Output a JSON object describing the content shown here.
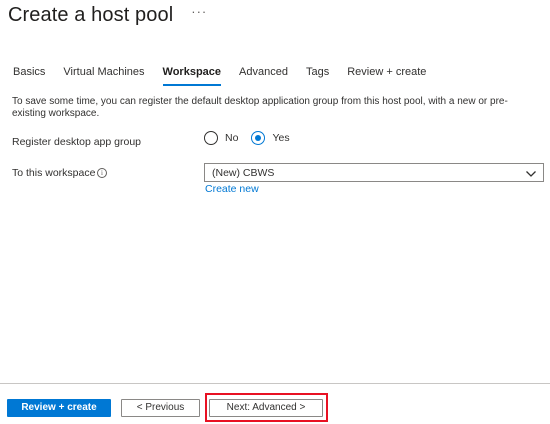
{
  "header": {
    "title": "Create a host pool",
    "more_icon": "more-ellipsis-icon",
    "more_label": "···"
  },
  "tabs": [
    {
      "label": "Basics",
      "active": false
    },
    {
      "label": "Virtual Machines",
      "active": false
    },
    {
      "label": "Workspace",
      "active": true
    },
    {
      "label": "Advanced",
      "active": false
    },
    {
      "label": "Tags",
      "active": false
    },
    {
      "label": "Review + create",
      "active": false
    }
  ],
  "description": "To save some time, you can register the default desktop application group from this host pool, with a new or pre-existing workspace.",
  "register": {
    "label": "Register desktop app group",
    "options": [
      {
        "label": "No",
        "checked": false
      },
      {
        "label": "Yes",
        "checked": true
      }
    ]
  },
  "workspace": {
    "label": "To this workspace",
    "info_icon": "info-icon",
    "selected": "(New) CBWS",
    "create_new_label": "Create new"
  },
  "footer": {
    "review_create_label": "Review + create",
    "previous_label": "< Previous",
    "next_label": "Next: Advanced >"
  },
  "colors": {
    "accent": "#0078d4",
    "highlight": "#e81123",
    "text": "#323130",
    "border": "#8a8886"
  }
}
